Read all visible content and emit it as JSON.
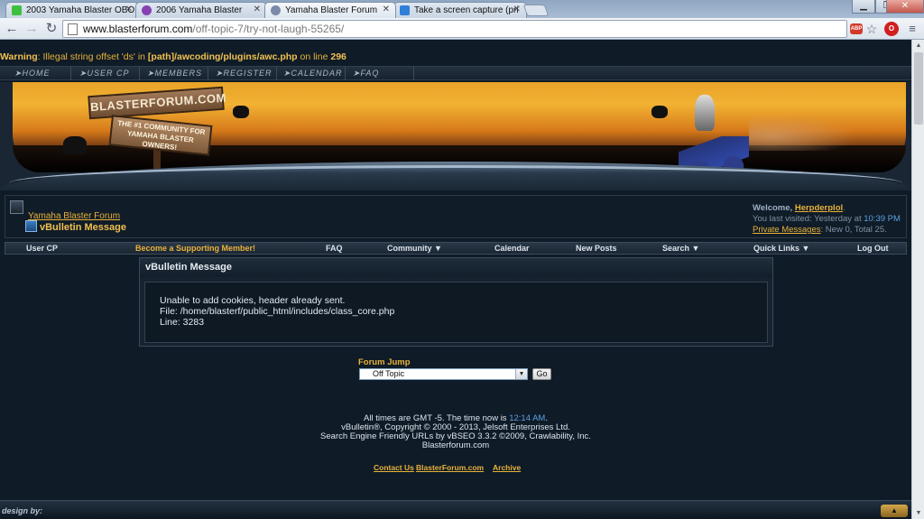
{
  "browser": {
    "tabs": [
      {
        "label": "2003 Yamaha Blaster OBO",
        "icon": "green-favicon",
        "color": "#3fbf3f"
      },
      {
        "label": "2006 Yamaha Blaster",
        "icon": "peace-favicon",
        "color": "#8a3fb3"
      },
      {
        "label": "Yamaha Blaster Forum",
        "icon": "forum-favicon",
        "color": "#7a8aa8"
      },
      {
        "label": "Take a screen capture (pri",
        "icon": "windows-favicon",
        "color": "#2f7fd8"
      }
    ],
    "url_host": "www.blasterforum.com",
    "url_path": "/off-topic-7/try-not-laugh-55265/",
    "ext_badge": "ABP"
  },
  "warning": {
    "prefix": "Warning",
    "text1": ": Illegal string offset 'ds' in ",
    "path": "[path]/awcoding/plugins/awc.php",
    "text2": " on line ",
    "line": "296"
  },
  "topnav": [
    "HOME",
    "USER CP",
    "MEMBERS",
    "REGISTER",
    "CALENDAR",
    "FAQ"
  ],
  "banner": {
    "logo": "BLASTERFORUM.COM",
    "tagline": "THE #1 COMMUNITY FOR YAMAHA BLASTER OWNERS!"
  },
  "breadcrumb": {
    "parent": "Yamaha Blaster Forum",
    "current": "vBulletin Message"
  },
  "welcome": {
    "label": "Welcome,",
    "username": "Herpderplol",
    "period": ".",
    "last_visited_label": "You last visited: Yesterday at",
    "last_visited_time": "10:39 PM",
    "pm_label": "Private Messages",
    "pm_counts": ": New 0, Total 25."
  },
  "navbar": [
    {
      "label": "User CP"
    },
    {
      "label": "Become a Supporting Member!"
    },
    {
      "label": "FAQ"
    },
    {
      "label": "Community ▼"
    },
    {
      "label": "Calendar"
    },
    {
      "label": "New Posts"
    },
    {
      "label": "Search ▼"
    },
    {
      "label": "Quick Links ▼"
    },
    {
      "label": "Log Out"
    }
  ],
  "message": {
    "header": "vBulletin Message",
    "line1": "Unable to add cookies, header already sent.",
    "line2": "File: /home/blasterf/public_html/includes/class_core.php",
    "line3": "Line: 3283"
  },
  "forum_jump": {
    "label": "Forum Jump",
    "selected": "Off Topic",
    "go": "Go"
  },
  "footer": {
    "time_prefix": "All times are GMT -5. The time now is",
    "time": "12:14 AM",
    "copyright": "vBulletin®, Copyright © 2000 - 2013, Jelsoft Enterprises Ltd.",
    "seo": "Search Engine Friendly URLs by vBSEO 3.3.2 ©2009, Crawlability, Inc.",
    "site": "Blasterforum.com",
    "links": [
      "Contact Us",
      "BlasterForum.com",
      "Archive"
    ]
  },
  "bottombar": {
    "design": "design by:"
  }
}
